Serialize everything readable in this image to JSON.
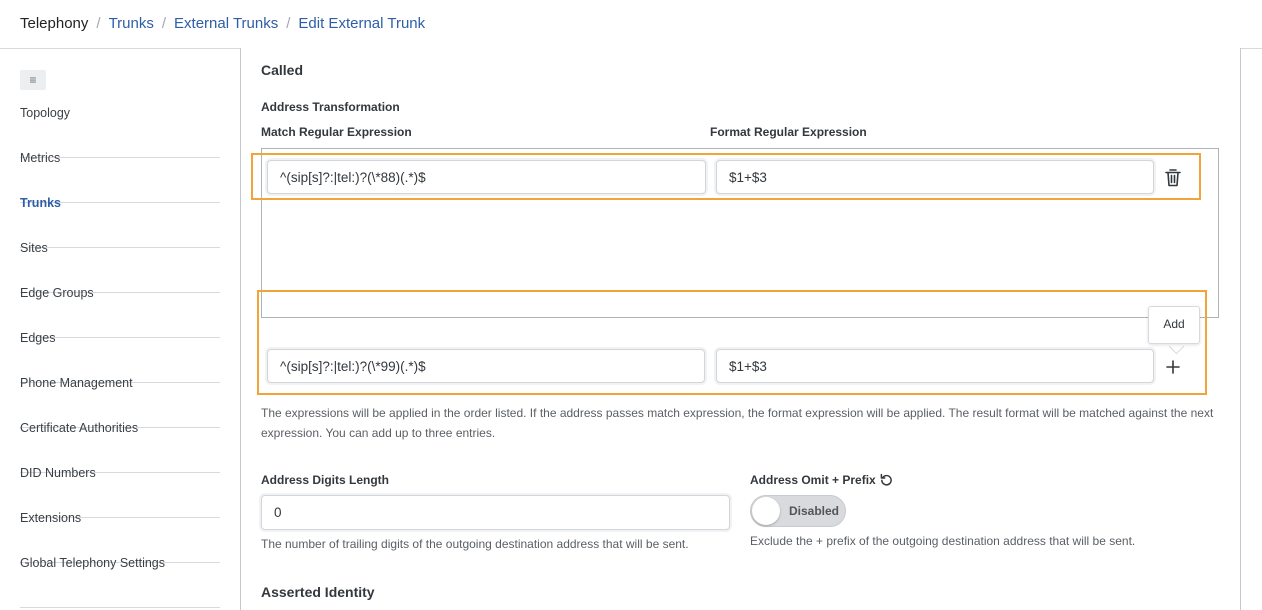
{
  "breadcrumb": {
    "root": "Telephony",
    "items": [
      "Trunks",
      "External Trunks",
      "Edit External Trunk"
    ],
    "separator": "/"
  },
  "sidebar": {
    "menu_icon": "hamburger-icon",
    "items": [
      {
        "label": "Topology"
      },
      {
        "label": "Metrics"
      },
      {
        "label": "Trunks",
        "active": true
      },
      {
        "label": "Sites"
      },
      {
        "label": "Edge Groups"
      },
      {
        "label": "Edges"
      },
      {
        "label": "Phone Management"
      },
      {
        "label": "Certificate Authorities"
      },
      {
        "label": "DID Numbers"
      },
      {
        "label": "Extensions"
      },
      {
        "label": "Global Telephony Settings"
      }
    ]
  },
  "main": {
    "called_title": "Called",
    "address_transformation_label": "Address Transformation",
    "match_regex_label": "Match Regular Expression",
    "format_regex_label": "Format Regular Expression",
    "rows": [
      {
        "match": "^(sip[s]?:|tel:)?(\\*88)(.*)$",
        "format": "$1+$3"
      }
    ],
    "new_row": {
      "match": "^(sip[s]?:|tel:)?(\\*99)(.*)$",
      "format": "$1+$3"
    },
    "add_tooltip": "Add",
    "expressions_help": "The expressions will be applied in the order listed. If the address passes match expression, the format expression will be applied. The result format will be matched against the next expression. You can add up to three entries.",
    "digits_length_label": "Address Digits Length",
    "digits_length_value": "0",
    "digits_length_help": "The number of trailing digits of the outgoing destination address that will be sent.",
    "omit_prefix_label": "Address Omit + Prefix",
    "omit_prefix_toggle": "Disabled",
    "omit_prefix_help": "Exclude the + prefix of the outgoing destination address that will be sent.",
    "asserted_identity_title": "Asserted Identity"
  },
  "colors": {
    "accent": "#2e5ea7",
    "highlight": "#f0a43a"
  }
}
